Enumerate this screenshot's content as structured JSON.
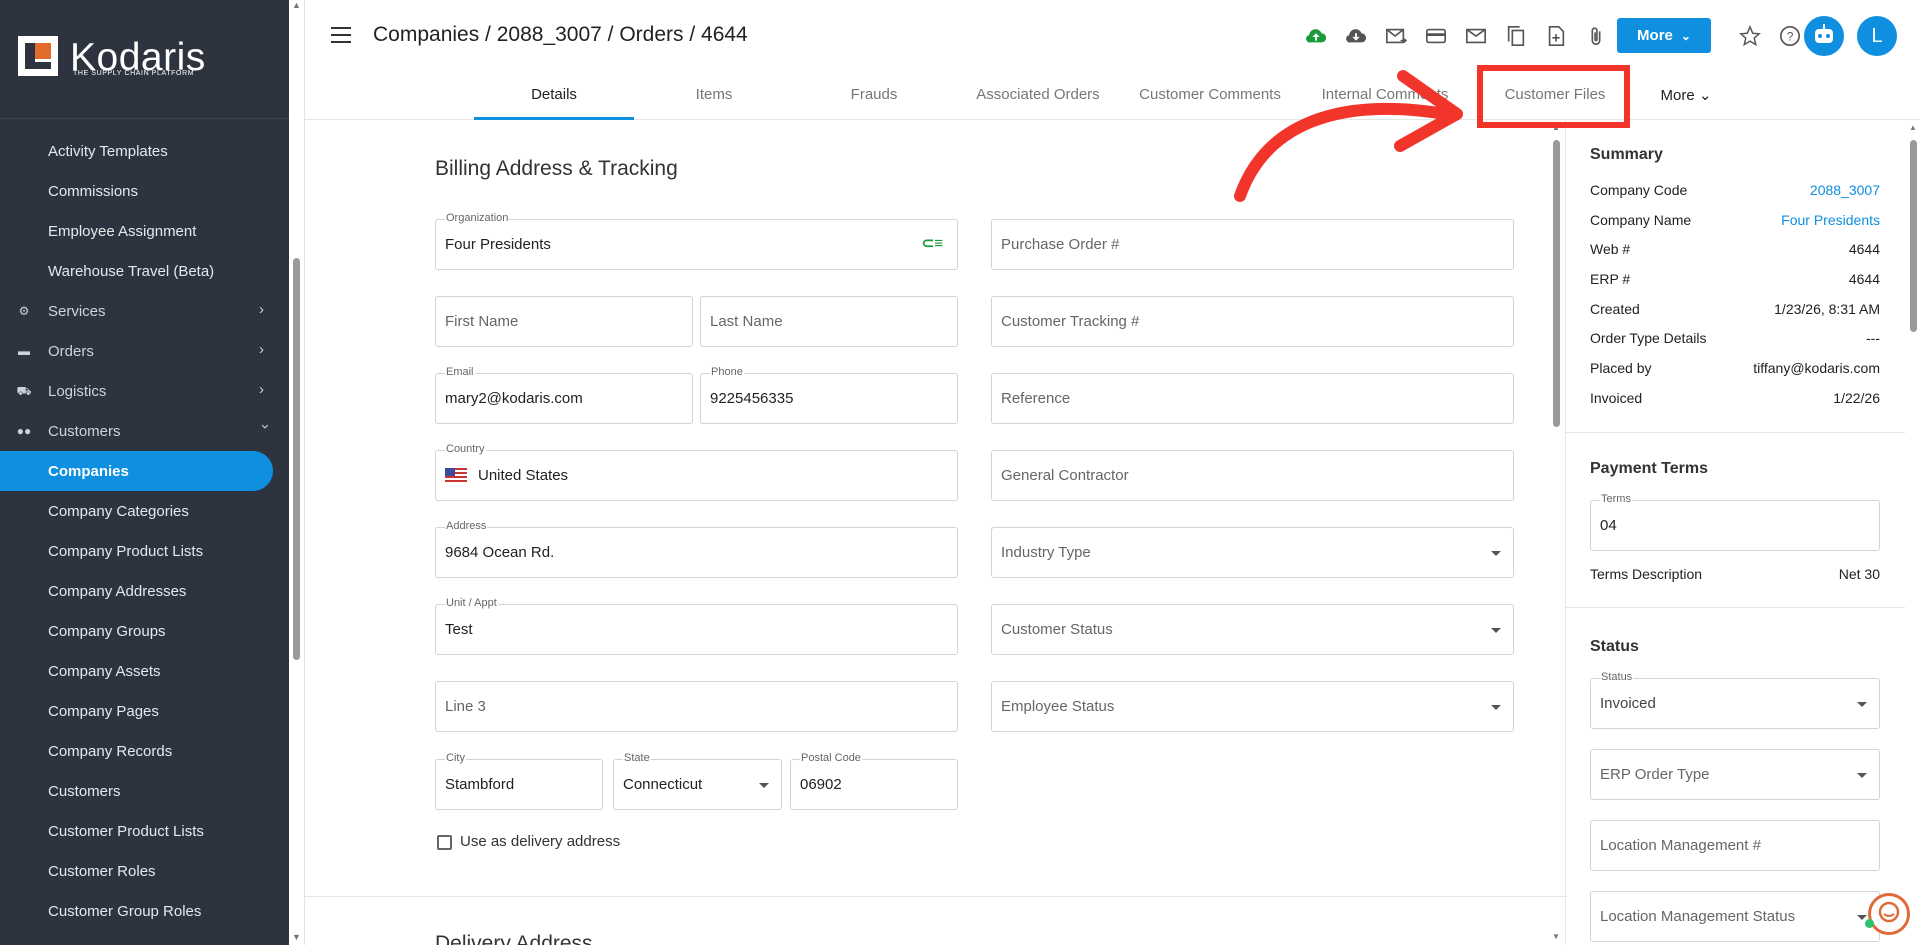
{
  "app": {
    "logo_text": "Kodaris",
    "logo_subtitle": "THE SUPPLY CHAIN PLATFORM"
  },
  "sidebar": {
    "items": [
      {
        "label": "Activity Templates"
      },
      {
        "label": "Commissions"
      },
      {
        "label": "Employee Assignment"
      },
      {
        "label": "Warehouse Travel (Beta)"
      },
      {
        "label": "Services",
        "icon": "gears-icon",
        "expandable": true
      },
      {
        "label": "Orders",
        "icon": "truck-icon",
        "expandable": true
      },
      {
        "label": "Logistics",
        "icon": "shipping-icon",
        "expandable": true
      },
      {
        "label": "Customers",
        "icon": "people-icon",
        "expanded": true
      },
      {
        "label": "Companies",
        "active": true
      },
      {
        "label": "Company Categories"
      },
      {
        "label": "Company Product Lists"
      },
      {
        "label": "Company Addresses"
      },
      {
        "label": "Company Groups"
      },
      {
        "label": "Company Assets"
      },
      {
        "label": "Company Pages"
      },
      {
        "label": "Company Records"
      },
      {
        "label": "Customers"
      },
      {
        "label": "Customer Product Lists"
      },
      {
        "label": "Customer Roles"
      },
      {
        "label": "Customer Group Roles"
      }
    ]
  },
  "header": {
    "breadcrumb": "Companies / 2088_3007 / Orders / 4644",
    "more_label": "More",
    "avatar_initial": "L",
    "icons": [
      "cloud-upload-icon",
      "cloud-download-icon",
      "mail-send-icon",
      "credit-card-icon",
      "mail-icon",
      "copy-icon",
      "file-add-icon",
      "attachment-icon",
      "star-icon",
      "help-icon",
      "bot-icon"
    ]
  },
  "tabs": [
    {
      "label": "Details",
      "active": true
    },
    {
      "label": "Items"
    },
    {
      "label": "Frauds"
    },
    {
      "label": "Associated Orders"
    },
    {
      "label": "Customer Comments"
    },
    {
      "label": "Internal Comments"
    },
    {
      "label": "Customer Files"
    },
    {
      "label": "More"
    }
  ],
  "billing": {
    "title": "Billing Address & Tracking",
    "organization_label": "Organization",
    "organization_value": "Four Presidents",
    "purchase_order_placeholder": "Purchase Order #",
    "first_name_placeholder": "First Name",
    "last_name_placeholder": "Last Name",
    "customer_tracking_placeholder": "Customer Tracking #",
    "email_label": "Email",
    "email_value": "mary2@kodaris.com",
    "phone_label": "Phone",
    "phone_value": "9225456335",
    "reference_placeholder": "Reference",
    "country_label": "Country",
    "country_value": "United States",
    "general_contractor_placeholder": "General Contractor",
    "address_label": "Address",
    "address_value": "9684 Ocean Rd.",
    "industry_type_placeholder": "Industry Type",
    "unit_label": "Unit / Appt",
    "unit_value": "Test",
    "customer_status_placeholder": "Customer Status",
    "line3_placeholder": "Line 3",
    "employee_status_placeholder": "Employee Status",
    "city_label": "City",
    "city_value": "Stambford",
    "state_label": "State",
    "state_value": "Connecticut",
    "postal_label": "Postal Code",
    "postal_value": "06902",
    "delivery_checkbox_label": "Use as delivery address"
  },
  "delivery": {
    "title": "Delivery Address"
  },
  "summary": {
    "title": "Summary",
    "rows": [
      {
        "key": "Company Code",
        "value": "2088_3007",
        "link": true
      },
      {
        "key": "Company Name",
        "value": "Four Presidents",
        "link": true
      },
      {
        "key": "Web #",
        "value": "4644"
      },
      {
        "key": "ERP #",
        "value": "4644"
      },
      {
        "key": "Created",
        "value": "1/23/26, 8:31 AM"
      },
      {
        "key": "Order Type Details",
        "value": "---"
      },
      {
        "key": "Placed by",
        "value": "tiffany@kodaris.com"
      },
      {
        "key": "Invoiced",
        "value": "1/22/26"
      }
    ]
  },
  "payment_terms": {
    "title": "Payment Terms",
    "terms_label": "Terms",
    "terms_value": "04",
    "description_key": "Terms Description",
    "description_value": "Net 30"
  },
  "status": {
    "title": "Status",
    "status_label": "Status",
    "status_value": "Invoiced",
    "erp_order_type_placeholder": "ERP Order Type",
    "location_mgmt_placeholder": "Location Management #",
    "location_mgmt_status_placeholder": "Location Management Status"
  },
  "colors": {
    "accent": "#0e8fe0",
    "sidebar_bg": "#2d3440",
    "callout": "#f2352b",
    "upload_green": "#1a9a3a"
  }
}
